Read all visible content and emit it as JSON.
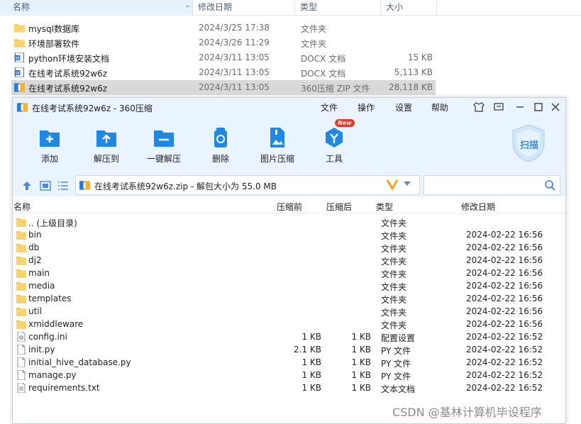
{
  "explorer": {
    "columns": {
      "name": "名称",
      "date": "修改日期",
      "type": "类型",
      "size": "大小"
    },
    "rows": [
      {
        "name": "mysql数据库",
        "date": "2024/3/25 17:38",
        "type": "文件夹",
        "size": "",
        "icon": "folder-icon"
      },
      {
        "name": "环境部署软件",
        "date": "2024/3/26 11:29",
        "type": "文件夹",
        "size": "",
        "icon": "folder-icon"
      },
      {
        "name": "python环境安装文档",
        "date": "2024/3/11 13:05",
        "type": "DOCX 文档",
        "size": "15 KB",
        "icon": "word-doc-icon"
      },
      {
        "name": "在线考试系统92w6z",
        "date": "2024/3/11 13:05",
        "type": "DOCX 文档",
        "size": "5,113 KB",
        "icon": "word-doc-icon"
      },
      {
        "name": "在线考试系统92w6z",
        "date": "2024/3/11 13:05",
        "type": "360压缩 ZIP 文件",
        "size": "28,118 KB",
        "icon": "zip-archive-icon",
        "selected": true
      }
    ]
  },
  "window": {
    "title": "在线考试系统92w6z - 360压缩",
    "menu": [
      "文件",
      "操作",
      "设置",
      "帮助"
    ],
    "toolbar": [
      {
        "label": "添加",
        "icon": "add-folder-icon"
      },
      {
        "label": "解压到",
        "icon": "extract-to-icon"
      },
      {
        "label": "一键解压",
        "icon": "one-click-extract-icon"
      },
      {
        "label": "删除",
        "icon": "recycle-bin-icon"
      },
      {
        "label": "图片压缩",
        "icon": "image-compress-icon"
      },
      {
        "label": "工具",
        "icon": "tools-icon"
      }
    ],
    "new_badge": "New",
    "scan_label": "扫描",
    "address": "在线考试系统92w6z.zip - 解包大小为 55.0 MB",
    "search_placeholder": "",
    "list_columns": {
      "name": "名称",
      "before": "压缩前",
      "after": "压缩后",
      "type": "类型",
      "date": "修改日期"
    },
    "files": [
      {
        "name": ".. (上级目录)",
        "before": "",
        "after": "",
        "type": "文件夹",
        "date": "",
        "icon": "folder-icon"
      },
      {
        "name": "bin",
        "before": "",
        "after": "",
        "type": "文件夹",
        "date": "2024-02-22 16:56",
        "icon": "folder-icon"
      },
      {
        "name": "db",
        "before": "",
        "after": "",
        "type": "文件夹",
        "date": "2024-02-22 16:56",
        "icon": "folder-icon"
      },
      {
        "name": "dj2",
        "before": "",
        "after": "",
        "type": "文件夹",
        "date": "2024-02-22 16:56",
        "icon": "folder-icon"
      },
      {
        "name": "main",
        "before": "",
        "after": "",
        "type": "文件夹",
        "date": "2024-02-22 16:56",
        "icon": "folder-icon"
      },
      {
        "name": "media",
        "before": "",
        "after": "",
        "type": "文件夹",
        "date": "2024-02-22 16:56",
        "icon": "folder-icon"
      },
      {
        "name": "templates",
        "before": "",
        "after": "",
        "type": "文件夹",
        "date": "2024-02-22 16:56",
        "icon": "folder-icon"
      },
      {
        "name": "util",
        "before": "",
        "after": "",
        "type": "文件夹",
        "date": "2024-02-22 16:56",
        "icon": "folder-icon"
      },
      {
        "name": "xmiddleware",
        "before": "",
        "after": "",
        "type": "文件夹",
        "date": "2024-02-22 16:56",
        "icon": "folder-icon"
      },
      {
        "name": "config.ini",
        "before": "1 KB",
        "after": "1 KB",
        "type": "配置设置",
        "date": "2024-02-22 16:52",
        "icon": "config-file-icon"
      },
      {
        "name": "init.py",
        "before": "2.1 KB",
        "after": "1 KB",
        "type": "PY 文件",
        "date": "2024-02-22 16:52",
        "icon": "file-icon"
      },
      {
        "name": "initial_hive_database.py",
        "before": "1 KB",
        "after": "1 KB",
        "type": "PY 文件",
        "date": "2024-02-22 16:52",
        "icon": "file-icon"
      },
      {
        "name": "manage.py",
        "before": "1 KB",
        "after": "1 KB",
        "type": "PY 文件",
        "date": "2024-02-22 16:52",
        "icon": "file-icon"
      },
      {
        "name": "requirements.txt",
        "before": "1 KB",
        "after": "1 KB",
        "type": "文本文档",
        "date": "2024-02-22 16:52",
        "icon": "text-file-icon"
      }
    ]
  },
  "watermark": "CSDN @基林计算机毕设程序",
  "colors": {
    "accent": "#1e88e5",
    "titlebar": "#e9f4ff",
    "folder": "#f6c24c",
    "selected_row": "#d9d9d9"
  }
}
